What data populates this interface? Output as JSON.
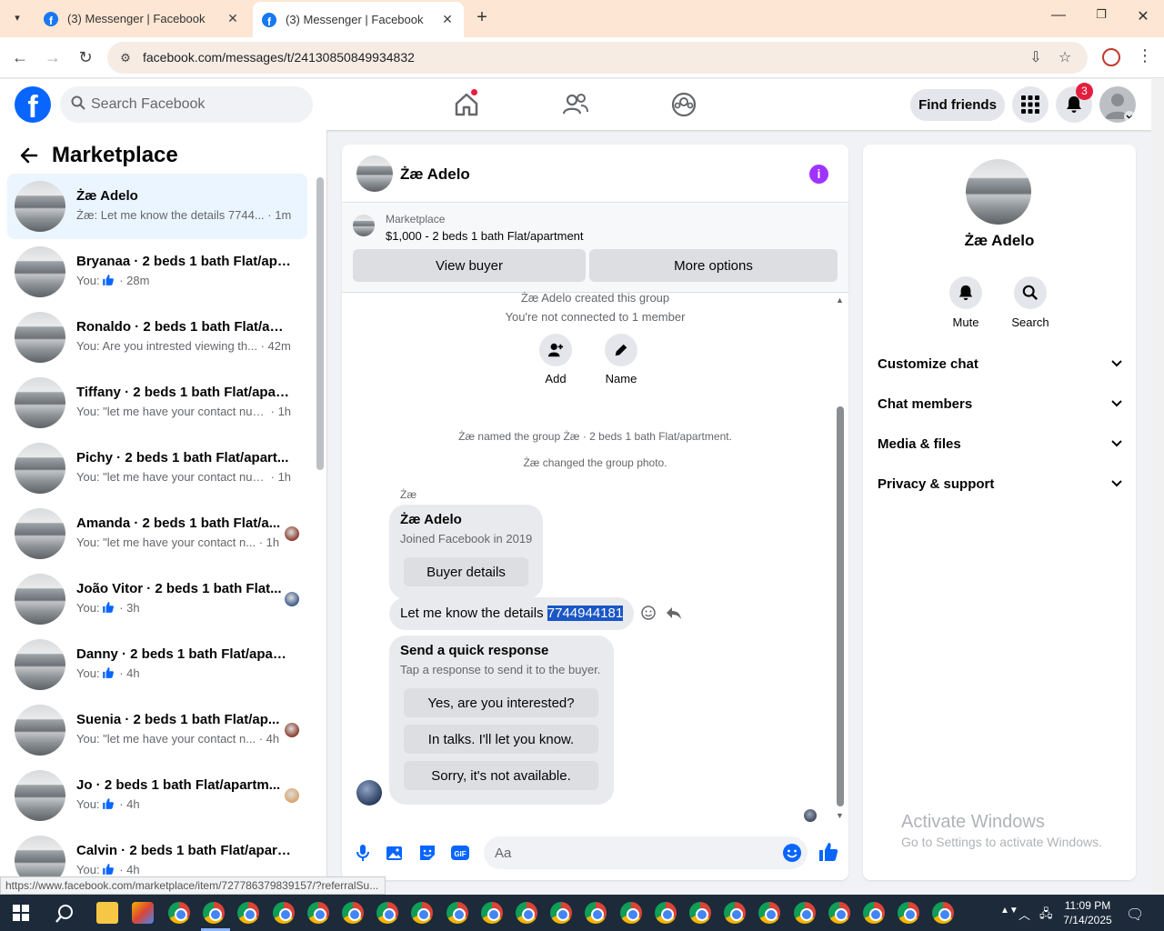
{
  "browser": {
    "tabs": [
      {
        "title": "(3) Messenger | Facebook"
      },
      {
        "title": "(3) Messenger | Facebook"
      }
    ],
    "url": "facebook.com/messages/t/24130850849934832",
    "status_url": "https://www.facebook.com/marketplace/item/727786379839157/?referralSu..."
  },
  "fb_header": {
    "search_placeholder": "Search Facebook",
    "find_friends": "Find friends",
    "notification_count": "3"
  },
  "left": {
    "title": "Marketplace",
    "chats": [
      {
        "name": "Żæ Adelo",
        "preview": "Żæ: Let me know the details 7744...",
        "time": "· 1m",
        "thumb": false,
        "active": true
      },
      {
        "name": "Bryanaa · 2 beds 1 bath Flat/apa...",
        "preview": "You:",
        "time": "· 28m",
        "thumb": true
      },
      {
        "name": "Ronaldo · 2 beds 1 bath Flat/apa...",
        "preview": "You: Are you intrested viewing th...",
        "time": "· 42m",
        "thumb": false
      },
      {
        "name": "Tiffany · 2 beds 1 bath Flat/apart...",
        "preview": "You: \"let me have your contact num...",
        "time": "· 1h",
        "thumb": false
      },
      {
        "name": "Pichy · 2 beds 1 bath Flat/apart...",
        "preview": "You: \"let me have your contact num...",
        "time": "· 1h",
        "thumb": false
      },
      {
        "name": "Amanda · 2 beds 1 bath Flat/a...",
        "preview": "You: \"let me have your contact n...",
        "time": "· 1h",
        "thumb": false,
        "seen": "#8a3b2e"
      },
      {
        "name": "João Vitor · 2 beds 1 bath Flat...",
        "preview": "You:",
        "time": "· 3h",
        "thumb": true,
        "seen": "#3c5a8a"
      },
      {
        "name": "Danny · 2 beds 1 bath Flat/apart...",
        "preview": "You:",
        "time": "· 4h",
        "thumb": true
      },
      {
        "name": "Suenia · 2 beds 1 bath Flat/ap...",
        "preview": "You: \"let me have your contact n...",
        "time": "· 4h",
        "thumb": false,
        "seen": "#8a3b2e"
      },
      {
        "name": "Jo · 2 beds 1 bath Flat/apartm...",
        "preview": "You:",
        "time": "· 4h",
        "thumb": true,
        "seen": "#d9a46a"
      },
      {
        "name": "Calvin · 2 beds 1 bath Flat/apart...",
        "preview": "You:",
        "time": "· 4h",
        "thumb": true
      }
    ]
  },
  "conversation": {
    "name": "Żæ Adelo",
    "marketplace_label": "Marketplace",
    "listing": "$1,000 - 2 beds 1 bath Flat/apartment",
    "view_buyer": "View buyer",
    "more_options": "More options",
    "created_group": "Żæ Adelo created this group",
    "not_connected": "You're not connected to 1 member",
    "add_label": "Add",
    "name_label": "Name",
    "named_group": "Żæ named the group Żæ · 2 beds 1 bath Flat/apartment.",
    "changed_photo": "Żæ changed the group photo.",
    "sender_short": "Żæ",
    "card_name": "Żæ Adelo",
    "card_joined": "Joined Facebook in 2019",
    "buyer_details": "Buyer details",
    "message_text": "Let me know the details ",
    "message_highlight": "7744944181",
    "quick_title": "Send a quick response",
    "quick_sub": "Tap a response to send it to the buyer.",
    "quick_responses": [
      "Yes, are you interested?",
      "In talks. I'll let you know.",
      "Sorry, it's not available."
    ],
    "composer_placeholder": "Aa"
  },
  "details": {
    "name": "Żæ Adelo",
    "mute": "Mute",
    "search": "Search",
    "sections": [
      "Customize chat",
      "Chat members",
      "Media & files",
      "Privacy & support"
    ]
  },
  "watermark": {
    "line1": "Activate Windows",
    "line2": "Go to Settings to activate Windows."
  },
  "taskbar": {
    "time": "11:09 PM",
    "date": "7/14/2025"
  },
  "colors": {
    "fb_blue": "#0866ff",
    "messenger_purple": "#a033ff",
    "highlight": "#1a56c5",
    "badge_red": "#e41e3f"
  }
}
